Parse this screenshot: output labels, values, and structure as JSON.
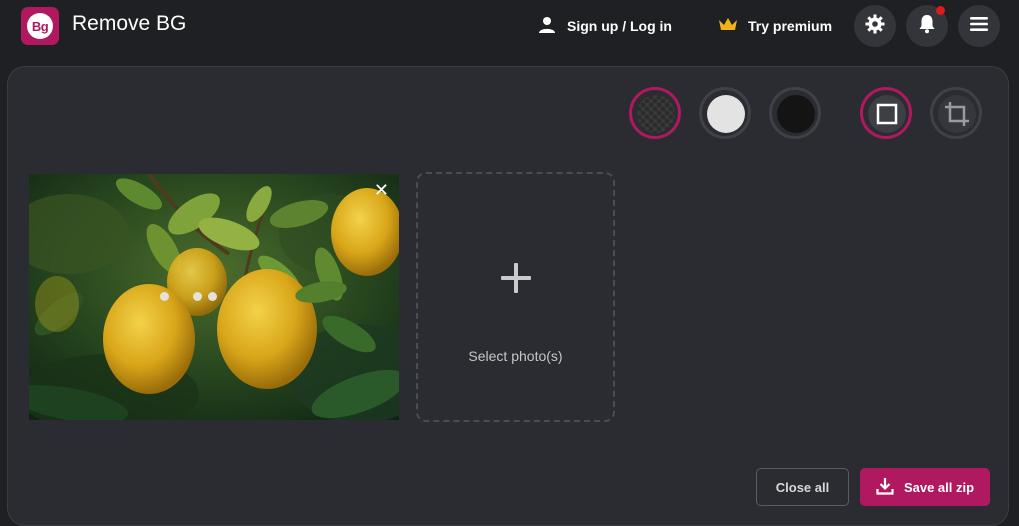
{
  "header": {
    "logo_text": "Bg",
    "app_title": "Remove BG",
    "signup_label": "Sign up / Log in",
    "premium_label": "Try premium",
    "icons": {
      "user": "user-icon",
      "crown": "crown-icon",
      "settings": "gear-icon",
      "notifications": "bell-icon",
      "menu": "hamburger-menu-icon"
    },
    "notification_badge": true
  },
  "toolbar": {
    "background_options": [
      {
        "name": "transparent",
        "selected": true
      },
      {
        "name": "white",
        "color": "#e3e3e3",
        "selected": false
      },
      {
        "name": "black",
        "color": "#141414",
        "selected": false
      }
    ],
    "mode_options": [
      {
        "name": "full-frame",
        "icon": "square-icon",
        "selected": true
      },
      {
        "name": "crop",
        "icon": "crop-icon",
        "selected": false
      }
    ]
  },
  "photos": [
    {
      "subject": "lemons on tree",
      "status": "processing"
    }
  ],
  "select_photo": {
    "label": "Select photo(s)"
  },
  "actions": {
    "close_all_label": "Close all",
    "save_zip_label": "Save all zip"
  },
  "colors": {
    "accent": "#b0195f",
    "background": "#1f2023",
    "panel": "#2a2c31",
    "notification": "#e0191f",
    "crown": "#f2b21a"
  }
}
